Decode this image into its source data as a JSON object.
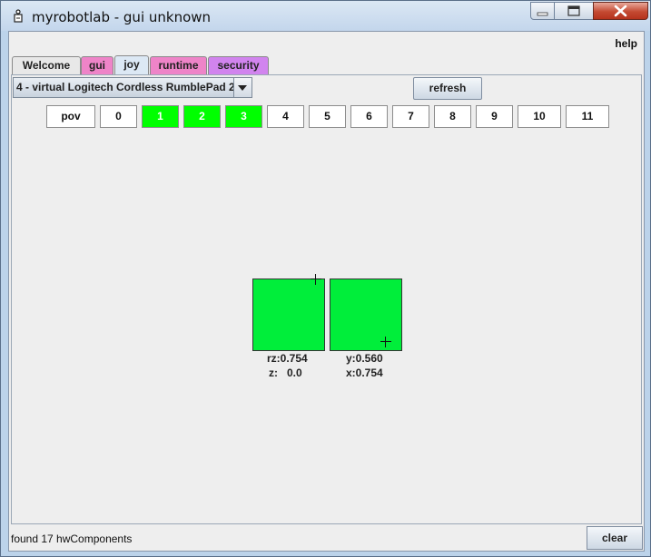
{
  "window": {
    "title": "myrobotlab - gui unknown"
  },
  "menu": {
    "help_label": "help"
  },
  "tabs": [
    {
      "label": "Welcome",
      "color": "#e8e8e8"
    },
    {
      "label": "gui",
      "color": "#ee84c8"
    },
    {
      "label": "joy",
      "color": "#dce8f4",
      "selected": true
    },
    {
      "label": "runtime",
      "color": "#ee84c8"
    },
    {
      "label": "security",
      "color": "#d184ee"
    }
  ],
  "joystick": {
    "selected_controller": "4 - virtual Logitech Cordless RumblePad 2",
    "refresh_label": "refresh",
    "buttons": [
      {
        "label": "pov",
        "pressed": false
      },
      {
        "label": "0",
        "pressed": false
      },
      {
        "label": "1",
        "pressed": true
      },
      {
        "label": "2",
        "pressed": true
      },
      {
        "label": "3",
        "pressed": true
      },
      {
        "label": "4",
        "pressed": false
      },
      {
        "label": "5",
        "pressed": false
      },
      {
        "label": "6",
        "pressed": false
      },
      {
        "label": "7",
        "pressed": false
      },
      {
        "label": "8",
        "pressed": false
      },
      {
        "label": "9",
        "pressed": false
      },
      {
        "label": "10",
        "pressed": false
      },
      {
        "label": "11",
        "pressed": false
      }
    ],
    "pressed_color": "#00ff00",
    "axis_color": "#00ee3a",
    "left_axis": {
      "rz": "rz:0.754",
      "z": "z:   0.0"
    },
    "right_axis": {
      "y": "y:0.560",
      "x": "x:0.754"
    }
  },
  "status": {
    "text": "found 17 hwComponents",
    "clear_label": "clear"
  }
}
